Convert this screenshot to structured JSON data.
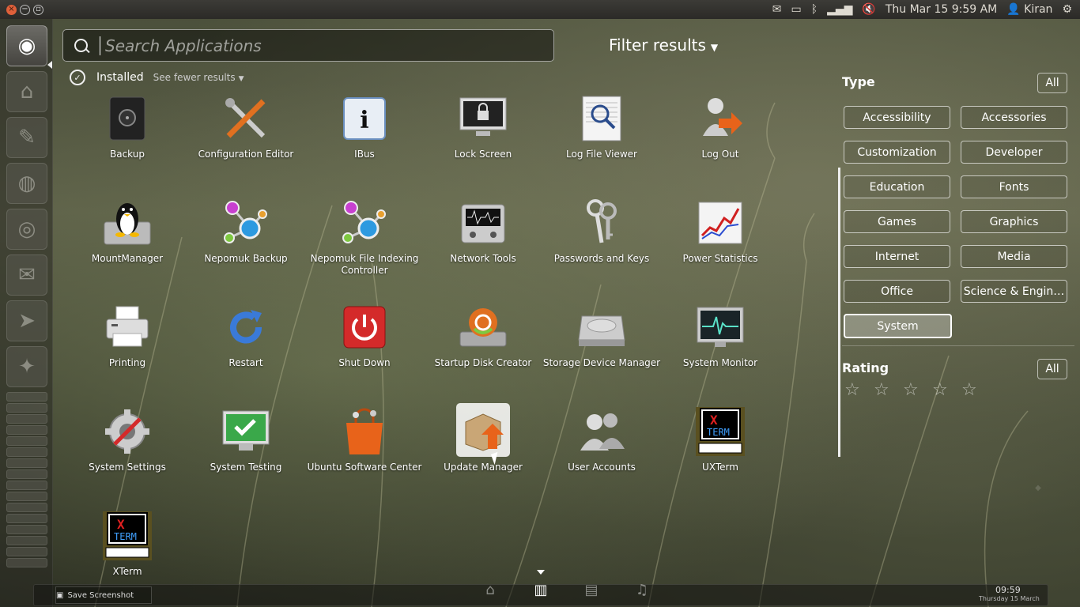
{
  "top_panel": {
    "datetime": "Thu Mar 15  9:59 AM",
    "user": "Kiran"
  },
  "search": {
    "placeholder": "Search Applications",
    "value": ""
  },
  "filter_results": {
    "label": "Filter results"
  },
  "installed": {
    "label": "Installed",
    "see_fewer": "See fewer results"
  },
  "apps": [
    {
      "label": "Backup",
      "icon": "backup-icon"
    },
    {
      "label": "Configuration Editor",
      "icon": "config-editor-icon"
    },
    {
      "label": "IBus",
      "icon": "ibus-icon"
    },
    {
      "label": "Lock Screen",
      "icon": "lock-screen-icon"
    },
    {
      "label": "Log File Viewer",
      "icon": "log-viewer-icon"
    },
    {
      "label": "Log Out",
      "icon": "log-out-icon"
    },
    {
      "label": "MountManager",
      "icon": "mount-manager-icon"
    },
    {
      "label": "Nepomuk Backup",
      "icon": "nepomuk-backup-icon"
    },
    {
      "label": "Nepomuk File Indexing Controller",
      "icon": "nepomuk-indexing-icon"
    },
    {
      "label": "Network Tools",
      "icon": "network-tools-icon"
    },
    {
      "label": "Passwords and Keys",
      "icon": "keys-icon"
    },
    {
      "label": "Power Statistics",
      "icon": "power-statistics-icon"
    },
    {
      "label": "Printing",
      "icon": "printer-icon"
    },
    {
      "label": "Restart",
      "icon": "restart-icon"
    },
    {
      "label": "Shut Down",
      "icon": "shutdown-icon"
    },
    {
      "label": "Startup Disk Creator",
      "icon": "startup-disk-icon"
    },
    {
      "label": "Storage Device Manager",
      "icon": "storage-device-icon"
    },
    {
      "label": "System Monitor",
      "icon": "system-monitor-icon"
    },
    {
      "label": "System Settings",
      "icon": "system-settings-icon"
    },
    {
      "label": "System Testing",
      "icon": "system-testing-icon"
    },
    {
      "label": "Ubuntu Software Center",
      "icon": "software-center-icon"
    },
    {
      "label": "Update Manager",
      "icon": "update-manager-icon"
    },
    {
      "label": "User Accounts",
      "icon": "user-accounts-icon"
    },
    {
      "label": "UXTerm",
      "icon": "uxterm-icon"
    },
    {
      "label": "XTerm",
      "icon": "xterm-icon"
    }
  ],
  "filters": {
    "type_heading": "Type",
    "all_label": "All",
    "types": [
      "Accessibility",
      "Accessories",
      "Customization",
      "Developer",
      "Education",
      "Fonts",
      "Games",
      "Graphics",
      "Internet",
      "Media",
      "Office",
      "Science & Engin…",
      "System"
    ],
    "active_type": "System",
    "rating_heading": "Rating",
    "rating_all_label": "All",
    "rating_stars": 5
  },
  "bottom": {
    "save_screenshot": "Save Screenshot",
    "clock_time": "09:59",
    "clock_date": "Thursday 15 March",
    "lenses": [
      "home-lens-icon",
      "applications-lens-icon",
      "files-lens-icon",
      "music-lens-icon"
    ],
    "active_lens": "applications-lens-icon"
  },
  "colors": {
    "accent": "#e0603a",
    "panel": "#3c3b37"
  }
}
